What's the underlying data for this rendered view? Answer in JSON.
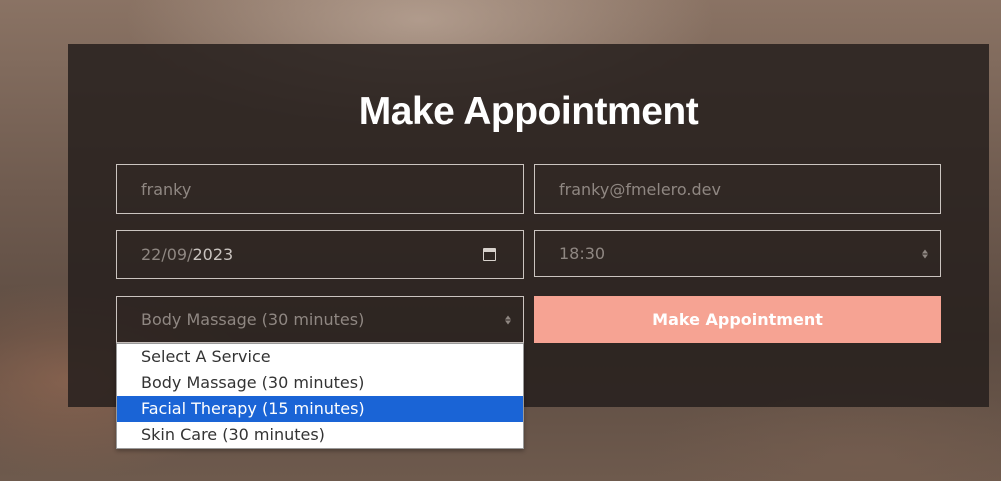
{
  "form": {
    "title": "Make Appointment",
    "name_value": "franky",
    "email_value": "franky@fmelero.dev",
    "date_day_month": "22/09/",
    "date_year": "2023",
    "time_value": "18:30",
    "service_value": "Body Massage (30 minutes)",
    "submit_label": "Make Appointment",
    "service_options": [
      {
        "label": "Select A Service",
        "selected": false
      },
      {
        "label": "Body Massage (30 minutes)",
        "selected": false
      },
      {
        "label": "Facial Therapy (15 minutes)",
        "selected": true
      },
      {
        "label": "Skin Care (30 minutes)",
        "selected": false
      }
    ]
  },
  "colors": {
    "accent": "#f6a393",
    "highlight": "#1a64d6"
  },
  "icons": {
    "date": "calendar-icon",
    "time": "spinner-icon",
    "service": "spinner-icon"
  }
}
